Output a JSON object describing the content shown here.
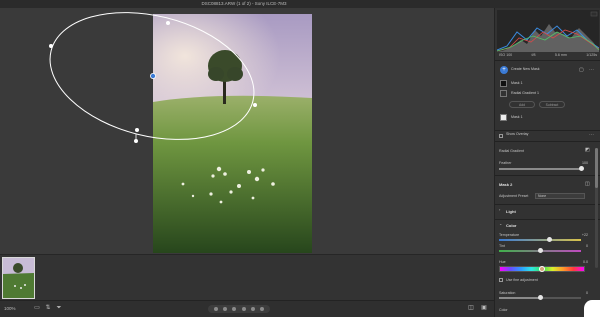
{
  "window": {
    "title": "DSC08813.ARW (1 of 2) - Sony ILCE-7M3"
  },
  "bottom_bar": {
    "zoom": "100%"
  },
  "histogram": {
    "meta": [
      "ISO 100",
      "f/8",
      "5.6 mm",
      "1/125s"
    ]
  },
  "masks": {
    "create_new": "Create New Mask",
    "mask1": "Mask 1",
    "radial_gradient": "Radial Gradient 1",
    "add": "Add",
    "subtract": "Subtract",
    "mask_row2": "Mask 1",
    "show_overlay": "Show Overlay"
  },
  "properties": {
    "radial_gradient_label": "Radial Gradient",
    "feather_label": "Feather",
    "feather_value": "100",
    "mask_title": "Mask 2",
    "adjustment_preset_label": "Adjustment Preset",
    "adjustment_preset_value": "None",
    "light_label": "Light",
    "color_label": "Color",
    "temperature_label": "Temperature",
    "temperature_value": "+22",
    "tint_label": "Tint",
    "tint_value": "0",
    "hue_label": "Hue",
    "hue_value": "0.0",
    "fine_adjust_label": "Use fine adjustment",
    "saturation_label": "Saturation",
    "saturation_value": "0",
    "color_label2": "Color"
  },
  "colors": {
    "accent": "#3b7bd6",
    "panel_bg": "#323232",
    "canvas_bg": "#3a3a3a"
  },
  "slider_levels": {
    "feather": 1.0,
    "temperature": 0.61,
    "tint": 0.5,
    "hue_knob": 0.5,
    "saturation": 0.5
  }
}
